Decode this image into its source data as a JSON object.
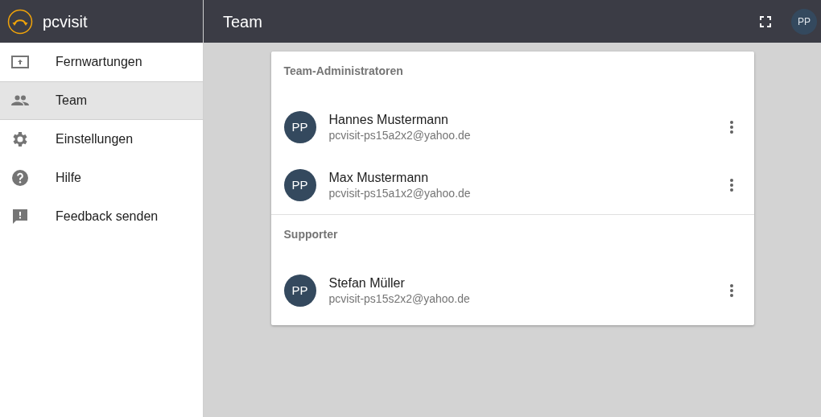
{
  "app": {
    "name": "pcvisit"
  },
  "sidebar": {
    "items": [
      {
        "label": "Fernwartungen",
        "selected": false
      },
      {
        "label": "Team",
        "selected": true
      },
      {
        "label": "Einstellungen",
        "selected": false
      },
      {
        "label": "Hilfe",
        "selected": false
      },
      {
        "label": "Feedback senden",
        "selected": false
      }
    ]
  },
  "header": {
    "title": "Team",
    "avatar": "PP"
  },
  "sections": [
    {
      "title": "Team-Administratoren",
      "members": [
        {
          "avatar": "PP",
          "name": "Hannes Mustermann",
          "email": "pcvisit-ps15a2x2@yahoo.de"
        },
        {
          "avatar": "PP",
          "name": "Max Mustermann",
          "email": "pcvisit-ps15a1x2@yahoo.de"
        }
      ]
    },
    {
      "title": "Supporter",
      "members": [
        {
          "avatar": "PP",
          "name": "Stefan Müller",
          "email": "pcvisit-ps15s2x2@yahoo.de"
        }
      ]
    }
  ]
}
